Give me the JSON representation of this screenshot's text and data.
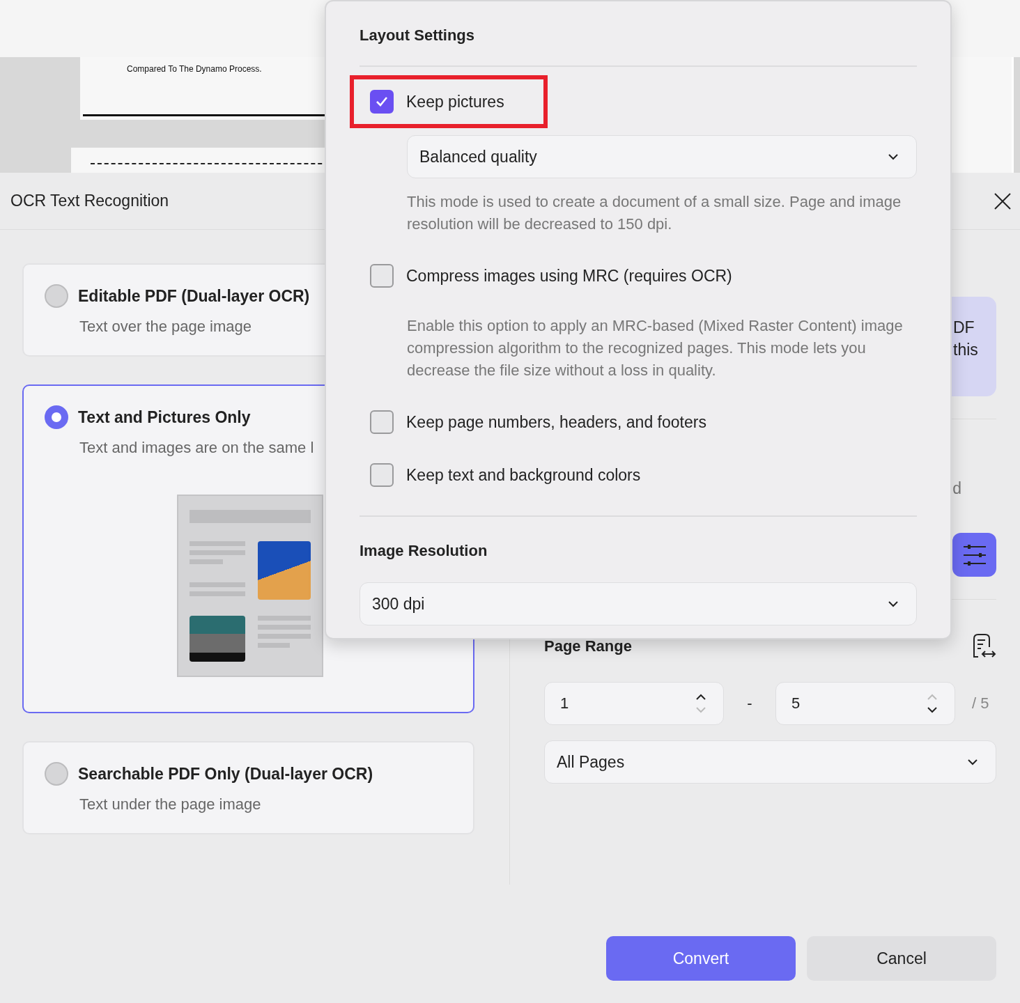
{
  "background_document": {
    "caption": "Compared To The Dynamo Process."
  },
  "dialog": {
    "title": "OCR Text Recognition",
    "options": [
      {
        "title": "Editable PDF (Dual-layer OCR)",
        "description": "Text over the page image",
        "selected": false
      },
      {
        "title": "Text and Pictures Only",
        "description": "Text and images are on the same l",
        "selected": true
      },
      {
        "title": "Searchable PDF Only (Dual-layer OCR)",
        "description": "Text under the page image",
        "selected": false
      }
    ],
    "info_card": {
      "lines": [
        "DF",
        "this"
      ]
    },
    "fragment": "d",
    "page_range": {
      "label": "Page Range",
      "from": "1",
      "separator": "-",
      "to": "5",
      "total": "/ 5",
      "scope": "All Pages"
    },
    "buttons": [
      {
        "label": "Convert",
        "kind": "primary"
      },
      {
        "label": "Cancel",
        "kind": "secondary"
      }
    ]
  },
  "layout_settings": {
    "title": "Layout Settings",
    "items": [
      {
        "kind": "checkbox",
        "label": "Keep pictures",
        "checked": true,
        "highlighted": true
      },
      {
        "kind": "select",
        "value": "Balanced quality"
      },
      {
        "kind": "note",
        "text": "This mode is used to create a document of a small size. Page and image resolution will be decreased to 150 dpi."
      },
      {
        "kind": "checkbox",
        "label": "Compress images using MRC (requires OCR)",
        "checked": false,
        "highlighted": false
      },
      {
        "kind": "note",
        "text": "Enable this option to apply an MRC-based (Mixed Raster Content) image compression algorithm to the recognized pages. This mode lets you decrease the file size without a loss in quality."
      },
      {
        "kind": "checkbox",
        "label": "Keep page numbers, headers, and footers",
        "checked": false,
        "highlighted": false
      },
      {
        "kind": "checkbox",
        "label": "Keep text and background colors",
        "checked": false,
        "highlighted": false
      }
    ],
    "image_resolution": {
      "label": "Image Resolution",
      "value": "300 dpi"
    }
  }
}
